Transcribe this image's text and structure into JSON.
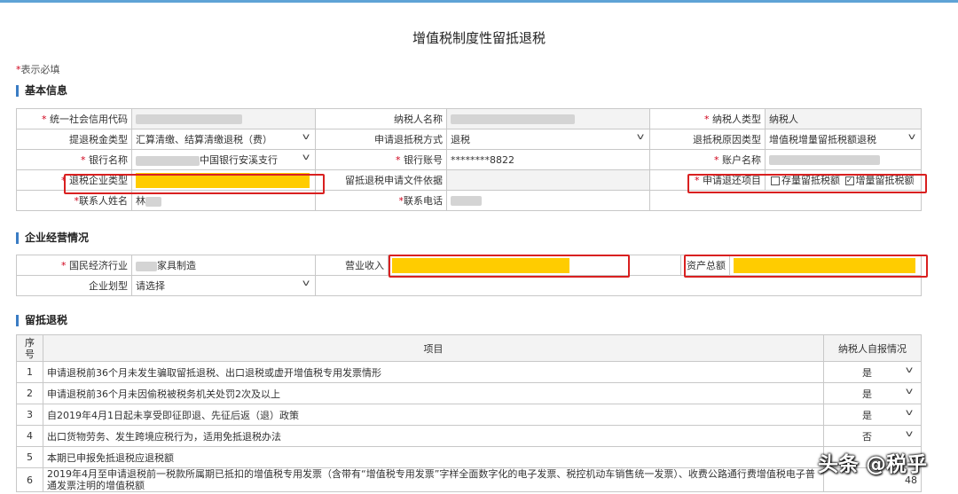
{
  "page": {
    "title": "增值税制度性留抵退税",
    "required_note": "表示必填",
    "required_mark": "*"
  },
  "sections": {
    "basic": "基本信息",
    "business": "企业经营情况",
    "refund": "留抵退税"
  },
  "basic_info": {
    "credit_code_label": "统一社会信用代码",
    "taxpayer_name_label": "纳税人名称",
    "taxpayer_type_label": "纳税人类型",
    "taxpayer_type_value": "纳税人",
    "refund_category_label": "提退税金类型",
    "refund_category_value": "汇算清缴、结算清缴退税（费）",
    "refund_method_label": "申请退抵税方式",
    "refund_method_value": "退税",
    "refund_reason_label": "退抵税原因类型",
    "refund_reason_value": "增值税增量留抵税额退税",
    "bank_name_label": "银行名称",
    "bank_name_value": "中国银行安溪支行",
    "bank_account_label": "银行账号",
    "bank_account_value": "********8822",
    "account_name_label": "账户名称",
    "enterprise_type_label": "退税企业类型",
    "basis_file_label": "留抵退税申请文件依据",
    "refund_item_label": "申请退还项目",
    "stock_option": "存量留抵税额",
    "increment_option": "增量留抵税额",
    "contact_name_label": "联系人姓名",
    "contact_name_value": "林",
    "contact_phone_label": "联系电话"
  },
  "business_info": {
    "industry_label": "国民经济行业",
    "industry_value": "家具制造",
    "revenue_label": "营业收入",
    "total_assets_label": "资产总额",
    "size_label": "企业划型",
    "size_value": "请选择"
  },
  "refund_table": {
    "headers": {
      "no": "序号",
      "item": "项目",
      "answer": "纳税人自报情况"
    },
    "rows": [
      {
        "no": "1",
        "item": "申请退税前36个月未发生骗取留抵退税、出口退税或虚开增值税专用发票情形",
        "answer": "是"
      },
      {
        "no": "2",
        "item": "申请退税前36个月未因偷税被税务机关处罚2次及以上",
        "answer": "是"
      },
      {
        "no": "3",
        "item": "自2019年4月1日起未享受即征即退、先征后返（退）政策",
        "answer": "是"
      },
      {
        "no": "4",
        "item": "出口货物劳务、发生跨境应税行为，适用免抵退税办法",
        "answer": "否"
      },
      {
        "no": "5",
        "item": "本期已申报免抵退税应退税额",
        "answer": ""
      },
      {
        "no": "6",
        "item": "2019年4月至申请退税前一税款所属期已抵扣的增值税专用发票（含带有“增值税专用发票”字样全面数字化的电子发票、税控机动车销售统一发票）、收费公路通行费增值税电子普通发票注明的增值税额",
        "answer": "48"
      }
    ]
  },
  "watermark": "头条 @税乎",
  "colors": {
    "highlight": "#ffcc00",
    "annotation": "#d92020",
    "accent": "#3a7cc4"
  }
}
